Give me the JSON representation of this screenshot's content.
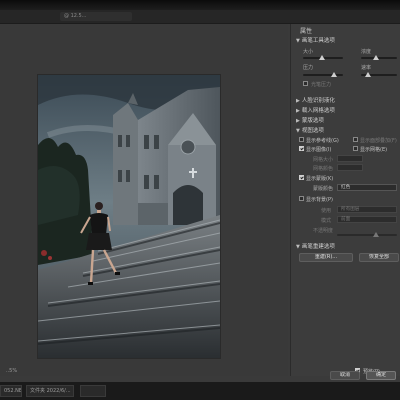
{
  "window": {
    "title_fragment": "@ 12.5..."
  },
  "preview": {
    "zoom_label": "..5%"
  },
  "panel": {
    "title": "属性",
    "brush_section": {
      "title": "画笔工具选项",
      "size_label": "大小",
      "density_label": "浓度",
      "pressure_label": "压力",
      "rate_label": "速率",
      "stylus_label": "光笔压力"
    },
    "sections_collapsed": [
      "人脸识别液化",
      "载入网格选项",
      "蒙版选项"
    ],
    "view_section": {
      "title": "视图选项",
      "show_guides": "显示参考线(G)",
      "show_face_overlay": "显示面部叠加(F)",
      "show_image": "显示图像(I)",
      "show_mesh": "显示网格(E)",
      "mesh_size_label": "网格大小",
      "mesh_color_label": "网格颜色"
    },
    "mask_section": {
      "show_mask": "显示蒙版(K)",
      "mask_color_label": "蒙版颜色",
      "mask_color_value": "红色"
    },
    "backdrop_section": {
      "show_backdrop": "显示背景(P)",
      "use_label": "使用",
      "use_value": "所有图层",
      "mode_label": "模式",
      "mode_value": "前面",
      "opacity_label": "不透明度"
    },
    "reconstruct_section": {
      "title": "画笔重建选项",
      "reconstruct_button": "重建(R)...",
      "restore_all_button": "恢复全部"
    },
    "preview_label": "预览(P)",
    "cancel_button": "取消",
    "ok_button": "确定"
  },
  "taskbar": {
    "items": [
      "052.NEF",
      "文件夹 2022/6/...",
      ""
    ]
  },
  "colors": {
    "dialog_bg": "#3a3a3a",
    "panel_bg": "#3c3c3c",
    "photo_sky": "#4b5a63",
    "dark": "#161616"
  }
}
